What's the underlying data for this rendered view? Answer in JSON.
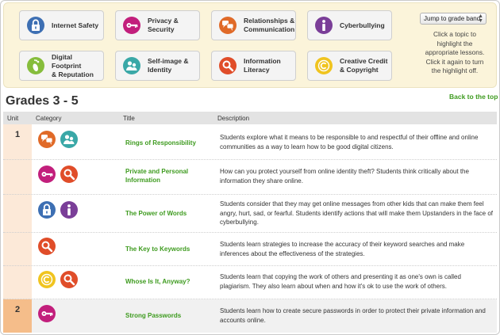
{
  "colors": {
    "blue": "#3d6fb3",
    "purple": "#7a3e98",
    "magenta": "#c21f7c",
    "orange": "#e06a28",
    "teal": "#3aa8a7",
    "green": "#86bd3c",
    "yellow": "#f0c41f",
    "red_orange": "#e04d29",
    "link_green": "#3e9b1f",
    "unit1_band": "#fce9d8",
    "unit2_band": "#f5bd8a"
  },
  "topics": [
    {
      "label_line1": "Internet Safety",
      "label_line2": "",
      "icon": "lock-icon",
      "color": "#3d6fb3"
    },
    {
      "label_line1": "Privacy &",
      "label_line2": "Security",
      "icon": "key-icon",
      "color": "#c21f7c"
    },
    {
      "label_line1": "Relationships &",
      "label_line2": "Communication",
      "icon": "speech-bubbles-icon",
      "color": "#e06a28"
    },
    {
      "label_line1": "Cyberbullying",
      "label_line2": "",
      "icon": "info-icon",
      "color": "#7a3e98"
    },
    {
      "label_line1": "Digital Footprint",
      "label_line2": "& Reputation",
      "icon": "footprint-icon",
      "color": "#86bd3c"
    },
    {
      "label_line1": "Self-image &",
      "label_line2": "Identity",
      "icon": "people-icon",
      "color": "#3aa8a7"
    },
    {
      "label_line1": "Information",
      "label_line2": "Literacy",
      "icon": "magnifier-icon",
      "color": "#e04d29"
    },
    {
      "label_line1": "Creative Credit",
      "label_line2": "& Copyright",
      "icon": "copyright-icon",
      "color": "#f0c41f"
    }
  ],
  "jump_select": {
    "value": "Jump to grade band"
  },
  "help_text": {
    "l1": "Click a topic to",
    "l2": "highlight the",
    "l3": "appropriate lessons.",
    "l4": "Click it again to turn",
    "l5": "the highlight off."
  },
  "grade_heading": "Grades 3 - 5",
  "back_to_top": "Back to the top",
  "table_header": {
    "unit": "Unit",
    "category": "Category",
    "title": "Title",
    "description": "Description"
  },
  "units": [
    {
      "number": "1"
    },
    {
      "number": "2"
    }
  ],
  "lessons": [
    {
      "title_l1": "Rings of Responsibility",
      "title_l2": "",
      "categories": [
        "speech-bubbles-icon",
        "people-icon"
      ],
      "desc_l1": "Students explore what it means to be responsible to and respectful of their offline and online",
      "desc_l2": "communities as a way to learn how to be good digital citizens.",
      "desc_l3": ""
    },
    {
      "title_l1": "Private and Personal",
      "title_l2": "Information",
      "categories": [
        "key-icon",
        "magnifier-icon"
      ],
      "desc_l1": "How can you protect yourself from online identity theft? Students think critically about the",
      "desc_l2": "information they share online.",
      "desc_l3": ""
    },
    {
      "title_l1": "The Power of Words",
      "title_l2": "",
      "categories": [
        "lock-icon",
        "info-icon"
      ],
      "desc_l1": "Students consider that they may get online messages from other kids that can make them feel",
      "desc_l2": "angry, hurt, sad, or fearful. Students identify actions that will make them Upstanders in the face of",
      "desc_l3": "cyberbullying."
    },
    {
      "title_l1": "The Key to Keywords",
      "title_l2": "",
      "categories": [
        "magnifier-icon"
      ],
      "desc_l1": "Students learn strategies to increase the accuracy of their keyword searches and make",
      "desc_l2": "inferences about the effectiveness of the strategies.",
      "desc_l3": ""
    },
    {
      "title_l1": "Whose Is It, Anyway?",
      "title_l2": "",
      "categories": [
        "copyright-icon",
        "magnifier-icon"
      ],
      "desc_l1": "Students learn that copying the work of others and presenting it as one's own is called",
      "desc_l2": "plagiarism. They also learn about when and how it's ok to use the work of others.",
      "desc_l3": ""
    },
    {
      "title_l1": "Strong Passwords",
      "title_l2": "",
      "categories": [
        "key-icon"
      ],
      "desc_l1": "Students learn how to create secure passwords in order to protect their private information and",
      "desc_l2": "accounts online.",
      "desc_l3": ""
    }
  ]
}
